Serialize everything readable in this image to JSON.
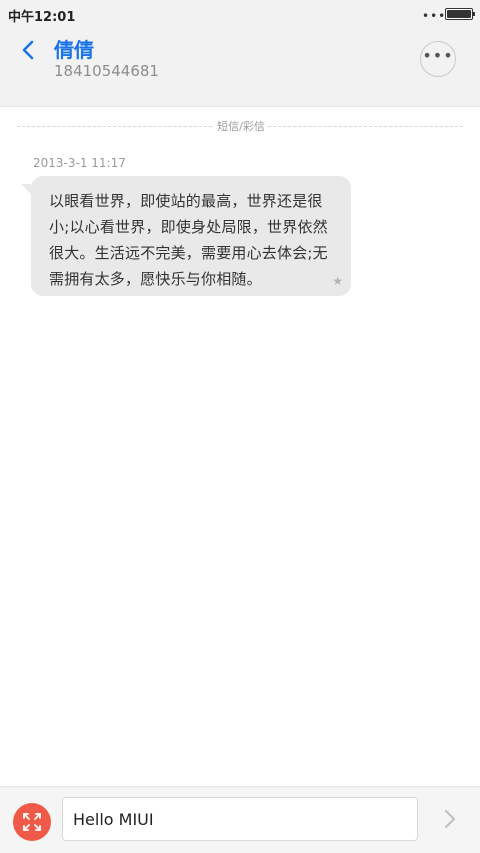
{
  "status_bar": {
    "time": "中午12:01",
    "dots": "•••",
    "battery_level": 1.0
  },
  "header": {
    "back_icon": "chevron-left-icon",
    "contact_name": "倩倩",
    "contact_number": "18410544681",
    "more_icon": "more-dots-icon",
    "more_text": "•••"
  },
  "conversation": {
    "message_type_label": "短信/彩信",
    "messages": [
      {
        "timestamp": "2013-3-1 11:17",
        "text": "以眼看世界，即使站的最高，世界还是很小;以心看世界，即使身处局限，世界依然很大。生活远不完美，需要用心去体会;无需拥有太多，愿快乐与你相随。",
        "star_icon": "star-icon",
        "star_glyph": "★"
      }
    ]
  },
  "composer": {
    "expand_icon": "expand-arrows-icon",
    "input_value": "Hello MIUI",
    "send_icon": "send-chevron-icon"
  },
  "colors": {
    "accent": "#1a73e8",
    "expand_button": "#f05a48",
    "bubble_incoming": "#e9e9e9"
  }
}
